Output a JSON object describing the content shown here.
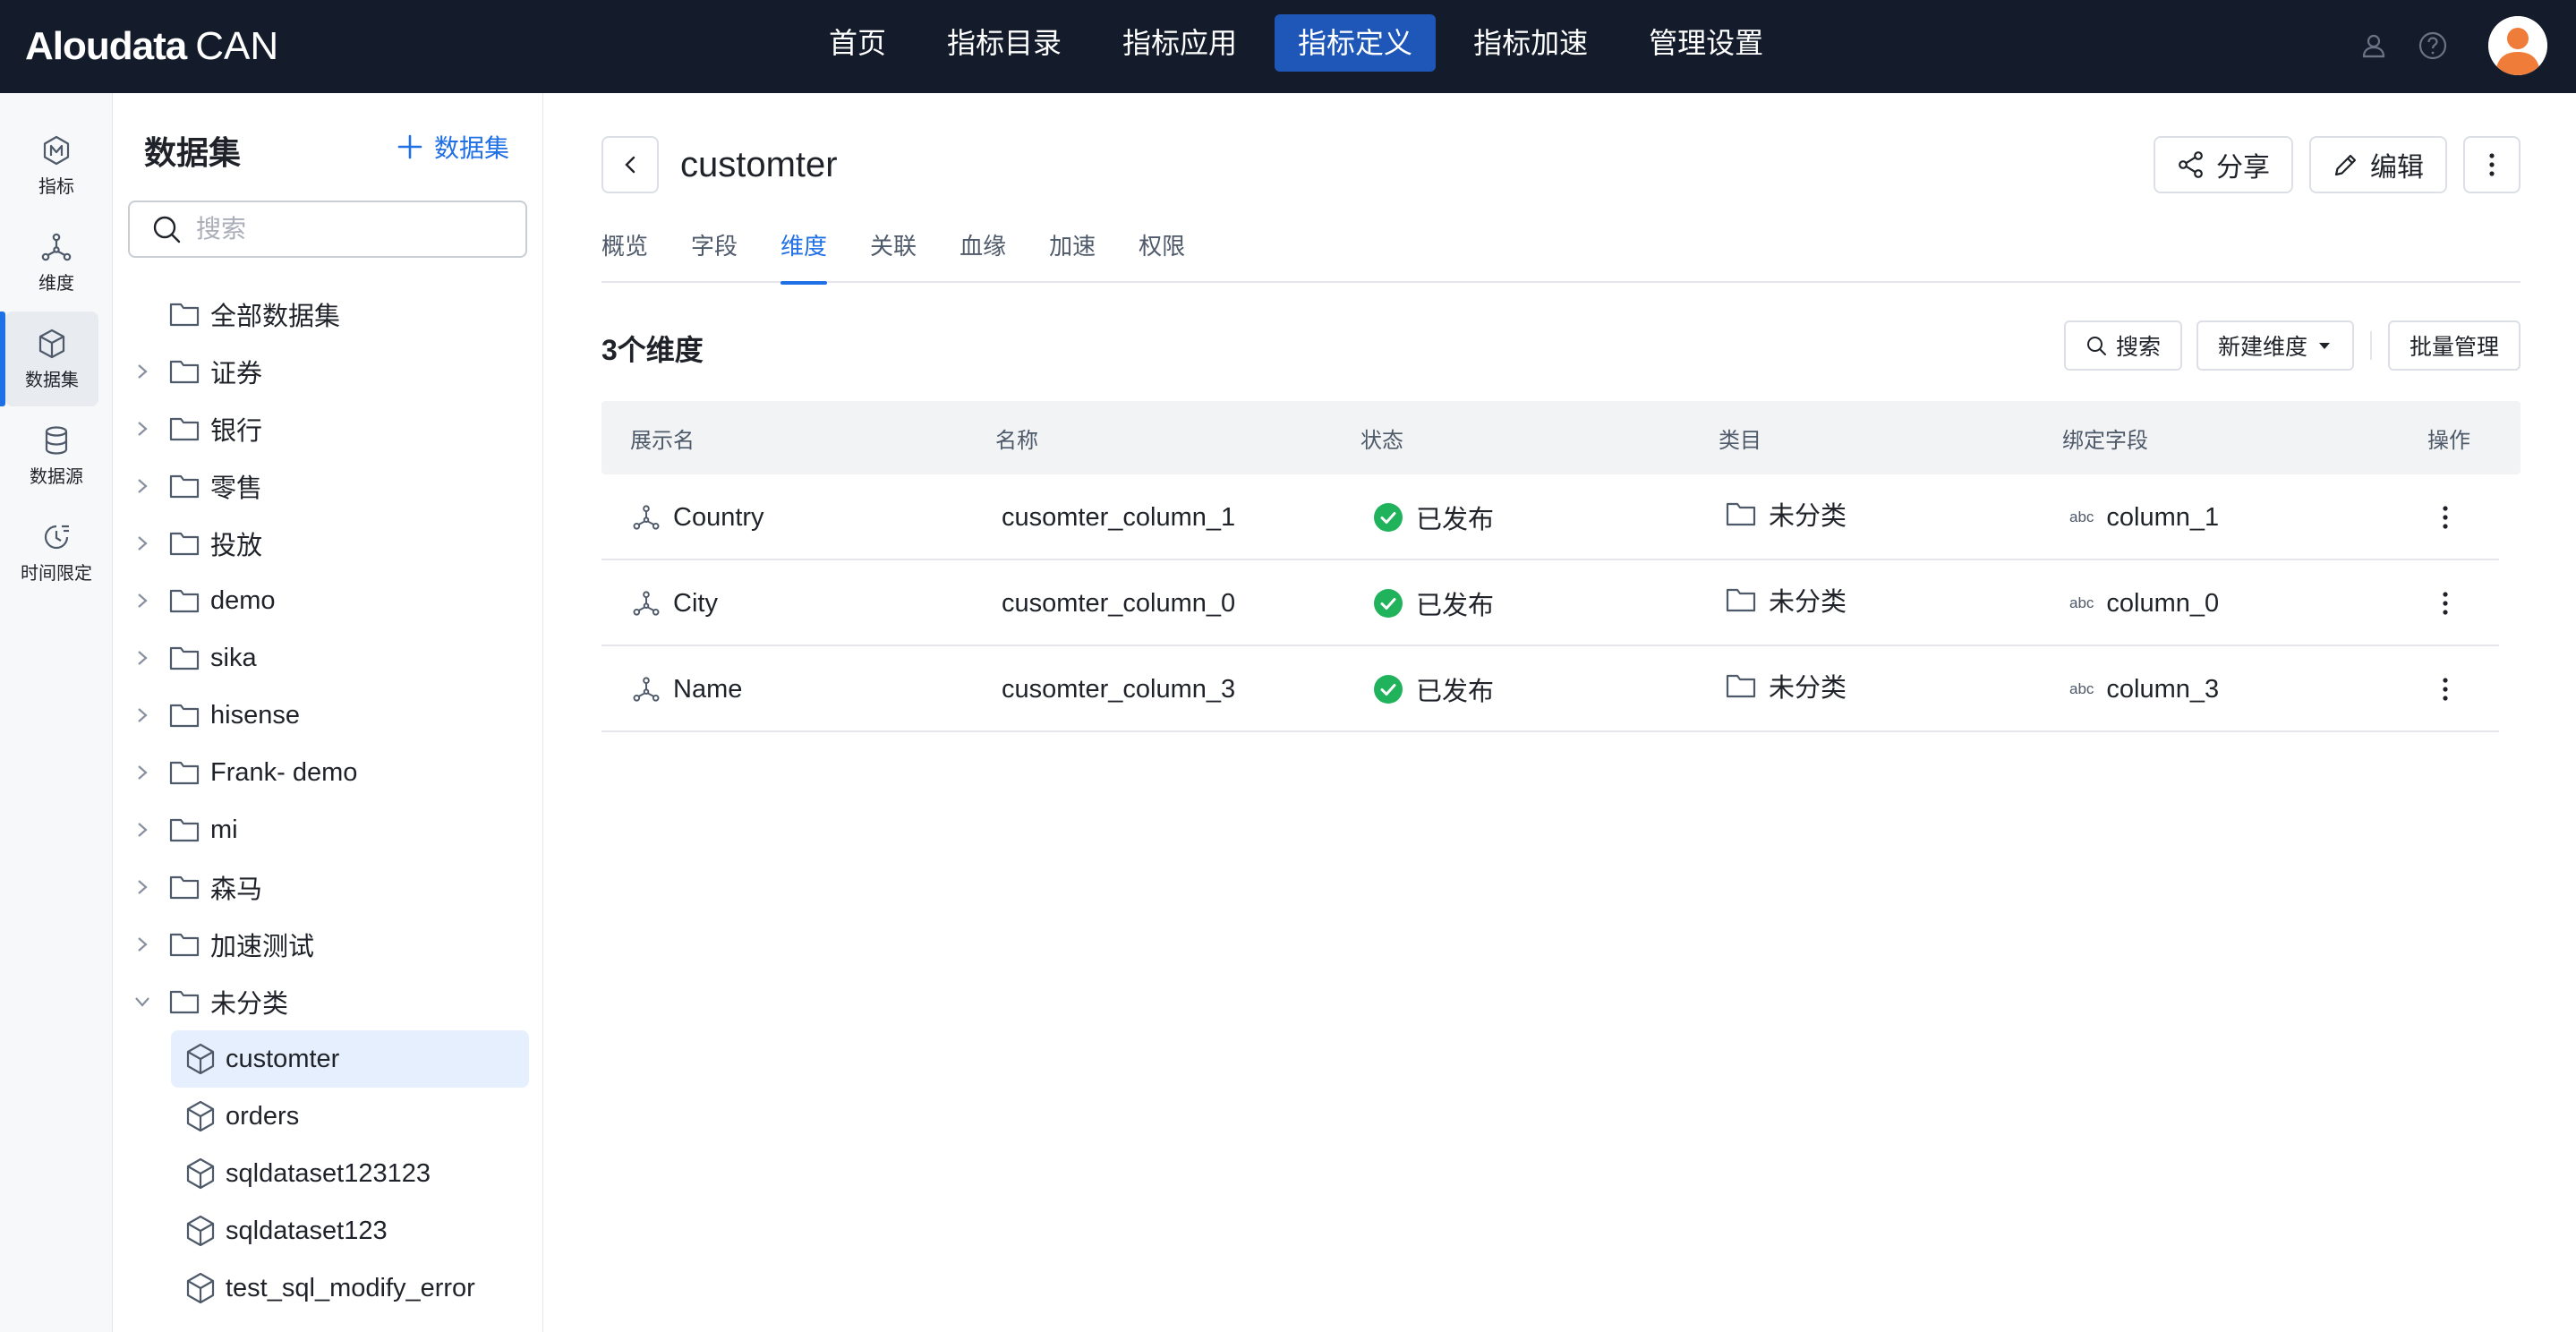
{
  "app": {
    "logo": "Aloudata",
    "logo_suffix": "CAN"
  },
  "topnav": {
    "items": [
      {
        "label": "首页"
      },
      {
        "label": "指标目录"
      },
      {
        "label": "指标应用"
      },
      {
        "label": "指标定义",
        "active": true
      },
      {
        "label": "指标加速"
      },
      {
        "label": "管理设置"
      }
    ],
    "icons": [
      "user-settings-icon",
      "help-icon",
      "avatar"
    ]
  },
  "rail": {
    "items": [
      {
        "label": "指标",
        "icon": "metric-icon"
      },
      {
        "label": "维度",
        "icon": "dimension-icon"
      },
      {
        "label": "数据集",
        "icon": "dataset-icon",
        "active": true
      },
      {
        "label": "数据源",
        "icon": "database-icon"
      },
      {
        "label": "时间限定",
        "icon": "time-limit-icon"
      }
    ]
  },
  "tree": {
    "title": "数据集",
    "add_label": "数据集",
    "search_placeholder": "搜索",
    "folders": [
      {
        "label": "全部数据集"
      },
      {
        "label": "证券"
      },
      {
        "label": "银行"
      },
      {
        "label": "零售"
      },
      {
        "label": "投放"
      },
      {
        "label": "demo"
      },
      {
        "label": "sika"
      },
      {
        "label": "hisense"
      },
      {
        "label": "Frank- demo"
      },
      {
        "label": "mi"
      },
      {
        "label": "森马"
      },
      {
        "label": "加速测试"
      },
      {
        "label": "未分类",
        "expanded": true
      }
    ],
    "datasets": [
      {
        "label": "customter",
        "selected": true
      },
      {
        "label": "orders"
      },
      {
        "label": "sqldataset123123"
      },
      {
        "label": "sqldataset123"
      },
      {
        "label": "test_sql_modify_error"
      }
    ]
  },
  "main": {
    "title": "customter",
    "actions": {
      "share": "分享",
      "edit": "编辑"
    },
    "tabs": [
      {
        "label": "概览"
      },
      {
        "label": "字段"
      },
      {
        "label": "维度",
        "active": true
      },
      {
        "label": "关联"
      },
      {
        "label": "血缘"
      },
      {
        "label": "加速"
      },
      {
        "label": "权限"
      }
    ],
    "section_title": "3个维度",
    "toolbar": {
      "search": "搜索",
      "new_dimension": "新建维度",
      "batch": "批量管理"
    },
    "table": {
      "headers": {
        "display_name": "展示名",
        "name": "名称",
        "status": "状态",
        "category": "类目",
        "bound_field": "绑定字段",
        "actions": "操作"
      },
      "rows": [
        {
          "display_name": "Country",
          "name": "cusomter_column_1",
          "status": "已发布",
          "category": "未分类",
          "field_type": "abc",
          "bound_field": "column_1"
        },
        {
          "display_name": "City",
          "name": "cusomter_column_0",
          "status": "已发布",
          "category": "未分类",
          "field_type": "abc",
          "bound_field": "column_0"
        },
        {
          "display_name": "Name",
          "name": "cusomter_column_3",
          "status": "已发布",
          "category": "未分类",
          "field_type": "abc",
          "bound_field": "column_3"
        }
      ]
    }
  },
  "colors": {
    "topbar": "#141c2b",
    "nav_active": "#1f57b8",
    "accent": "#1f6fe5",
    "published": "#21b35b",
    "avatar": "#f07c3a"
  }
}
